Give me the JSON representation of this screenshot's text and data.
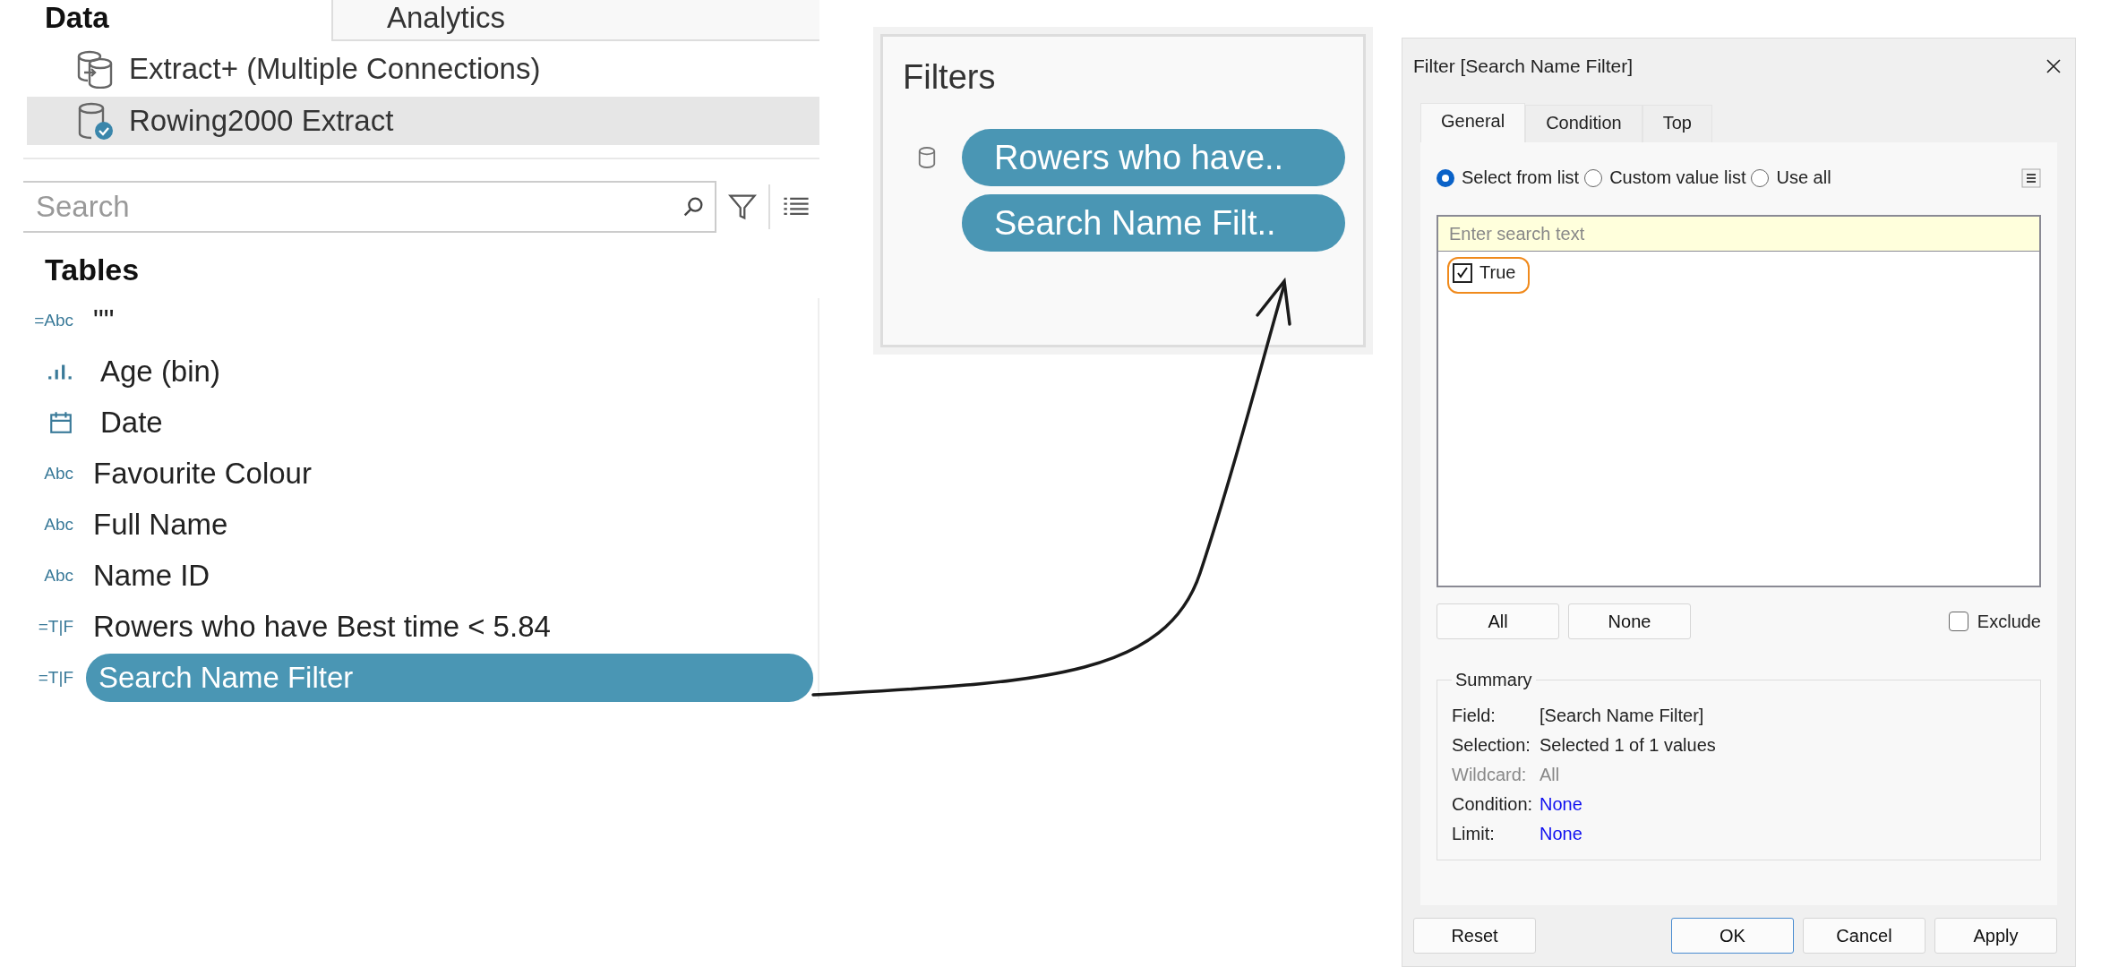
{
  "data_pane": {
    "tabs": [
      {
        "label": "Data",
        "selected": true
      },
      {
        "label": "Analytics",
        "selected": false
      }
    ],
    "data_sources": [
      {
        "name": "Extract+ (Multiple Connections)",
        "kind": "multi",
        "selected": false
      },
      {
        "name": "Rowing2000 Extract",
        "kind": "extract",
        "selected": true
      }
    ],
    "search": {
      "placeholder": "Search"
    },
    "tables_heading": "Tables",
    "fields": [
      {
        "kind": "text",
        "type_label": "=Abc",
        "name": "\"\"",
        "selected": false
      },
      {
        "kind": "bin",
        "name": "Age (bin)",
        "selected": false
      },
      {
        "kind": "date",
        "name": "Date",
        "selected": false
      },
      {
        "kind": "text",
        "type_label": "Abc",
        "name": "Favourite Colour",
        "selected": false
      },
      {
        "kind": "text",
        "type_label": "Abc",
        "name": "Full Name",
        "selected": false
      },
      {
        "kind": "text",
        "type_label": "Abc",
        "name": "Name ID",
        "selected": false
      },
      {
        "kind": "text",
        "type_label": "=T|F",
        "name": "Rowers who have Best time < 5.84",
        "selected": false
      },
      {
        "kind": "text",
        "type_label": "=T|F",
        "name": "Search Name Filter",
        "selected": true
      }
    ]
  },
  "filters_card": {
    "title": "Filters",
    "pills": [
      "Rowers who have..",
      "Search Name Filt.."
    ]
  },
  "dialog": {
    "title": "Filter [Search Name Filter]",
    "tabs": [
      {
        "label": "General",
        "selected": true
      },
      {
        "label": "Condition",
        "selected": false
      },
      {
        "label": "Top",
        "selected": false
      }
    ],
    "modes": [
      {
        "label": "Select from list",
        "selected": true
      },
      {
        "label": "Custom value list",
        "selected": false
      },
      {
        "label": "Use all",
        "selected": false
      }
    ],
    "search": {
      "placeholder": "Enter search text"
    },
    "values": [
      {
        "label": "True",
        "checked": true,
        "highlighted": true
      }
    ],
    "list_buttons": [
      "All",
      "None"
    ],
    "exclude": {
      "label": "Exclude",
      "checked": false
    },
    "summary": {
      "title": "Summary",
      "rows": [
        {
          "label": "Field:",
          "value": "[Search Name Filter]",
          "kind": "normal"
        },
        {
          "label": "Selection:",
          "value": "Selected 1 of 1 values",
          "kind": "normal"
        },
        {
          "label": "Wildcard:",
          "value": "All",
          "kind": "disabled"
        },
        {
          "label": "Condition:",
          "value": "None",
          "kind": "link"
        },
        {
          "label": "Limit:",
          "value": "None",
          "kind": "link"
        }
      ]
    },
    "footer": {
      "left_buttons": [
        {
          "label": "Reset",
          "default": false
        }
      ],
      "right_buttons": [
        {
          "label": "OK",
          "default": true
        },
        {
          "label": "Cancel",
          "default": false
        },
        {
          "label": "Apply",
          "default": false
        }
      ]
    }
  }
}
